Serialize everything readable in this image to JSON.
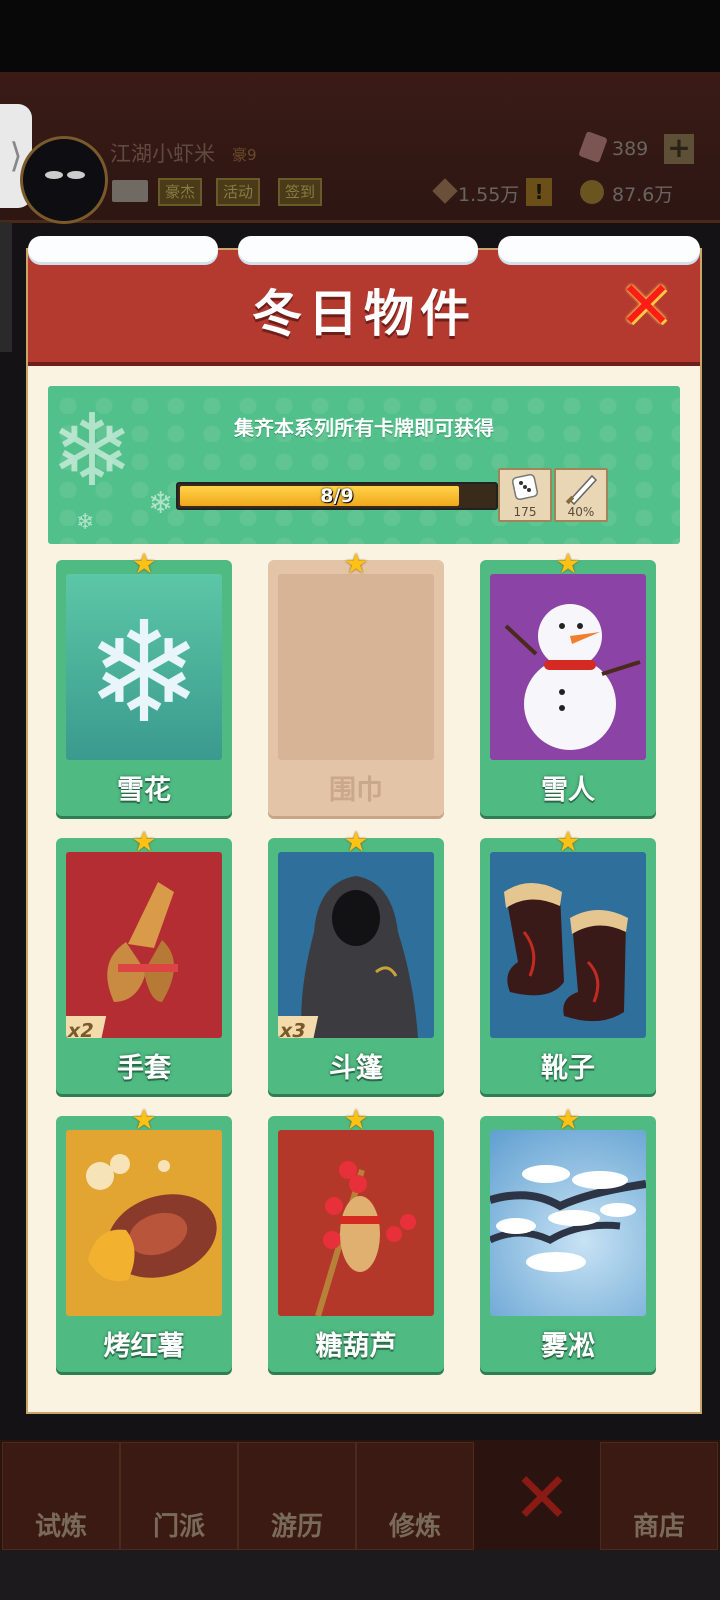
{
  "header": {
    "player_name": "江湖小虾米",
    "player_rank": "豪9",
    "buttons": [
      "豪杰",
      "活动",
      "签到"
    ],
    "gems": "389",
    "resource_a": "1.55万",
    "resource_b": "87.6万"
  },
  "modal": {
    "title": "冬日物件",
    "collect_text": "集齐本系列所有卡牌即可获得",
    "progress": {
      "label": "8/9",
      "collected": 8,
      "total": 9
    },
    "rewards": [
      {
        "icon": "dice-icon",
        "value": "175"
      },
      {
        "icon": "blade-icon",
        "value": "40%"
      }
    ],
    "cards": [
      {
        "name": "雪花",
        "locked": false,
        "count": "",
        "art": "snowflake"
      },
      {
        "name": "围巾",
        "locked": true,
        "count": "",
        "art": "none"
      },
      {
        "name": "雪人",
        "locked": false,
        "count": "",
        "art": "snowman"
      },
      {
        "name": "手套",
        "locked": false,
        "count": "x2",
        "art": "gloves"
      },
      {
        "name": "斗篷",
        "locked": false,
        "count": "x3",
        "art": "cloak"
      },
      {
        "name": "靴子",
        "locked": false,
        "count": "",
        "art": "boots"
      },
      {
        "name": "烤红薯",
        "locked": false,
        "count": "",
        "art": "sweet-potato"
      },
      {
        "name": "糖葫芦",
        "locked": false,
        "count": "",
        "art": "candied-haws"
      },
      {
        "name": "雾凇",
        "locked": false,
        "count": "",
        "art": "rime"
      }
    ]
  },
  "bottom_nav": [
    "试炼",
    "门派",
    "游历",
    "修炼",
    "",
    "商店"
  ],
  "colors": {
    "header_red": "#b43a30",
    "banner_green": "#52c08a",
    "card_green": "#4fbb82",
    "progress_yellow": "#ffd34a",
    "close_red": "#ff1e16",
    "star_gold": "#ffc214"
  }
}
